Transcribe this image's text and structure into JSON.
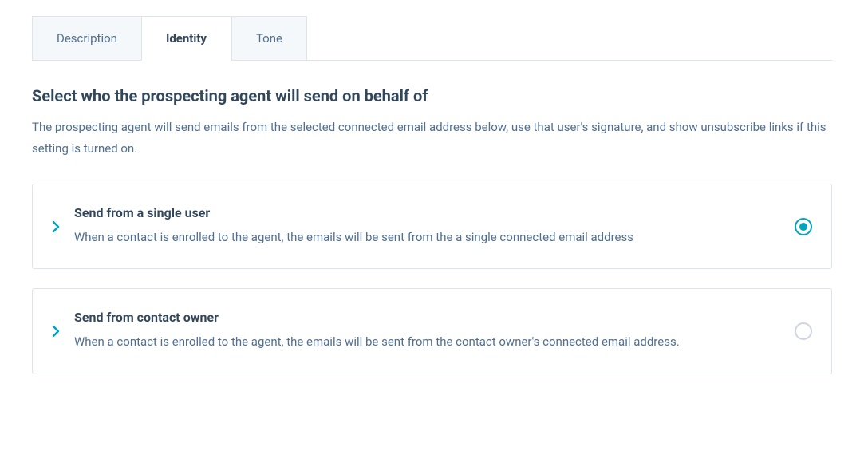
{
  "tabs": [
    {
      "label": "Description",
      "active": false
    },
    {
      "label": "Identity",
      "active": true
    },
    {
      "label": "Tone",
      "active": false
    }
  ],
  "heading": "Select who the prospecting agent will send on behalf of",
  "subheading": "The prospecting agent will send emails from the selected connected email address below, use that user's signature, and show unsubscribe links if this setting is turned on.",
  "options": [
    {
      "title": "Send from a single user",
      "description": "When a contact is enrolled to the agent, the emails will be sent from the a single connected email address",
      "selected": true
    },
    {
      "title": "Send from contact owner",
      "description": "When a contact is enrolled to the agent, the emails will be sent from the contact owner's connected email address.",
      "selected": false
    }
  ]
}
